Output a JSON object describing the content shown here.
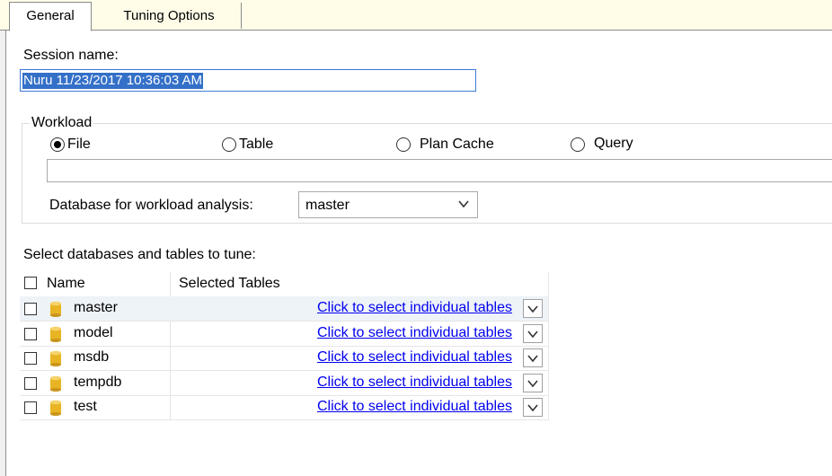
{
  "tabs": [
    "General",
    "Tuning Options"
  ],
  "session": {
    "label": "Session name:",
    "value": "Nuru 11/23/2017 10:36:03 AM"
  },
  "workload": {
    "legend": "Workload",
    "options": [
      {
        "label": "File",
        "checked": true
      },
      {
        "label": "Table",
        "checked": false
      },
      {
        "label": "Plan Cache",
        "checked": false
      },
      {
        "label": "Query",
        "checked": false
      }
    ],
    "input_value": "",
    "db_label": "Database for workload analysis:",
    "db_selected": "master"
  },
  "grid": {
    "caption": "Select databases and tables to tune:",
    "headers": {
      "name": "Name",
      "tables": "Selected Tables"
    },
    "rows": [
      {
        "name": "master",
        "link": "Click to select individual tables",
        "checked": false
      },
      {
        "name": "model",
        "link": "Click to select individual tables",
        "checked": false
      },
      {
        "name": "msdb",
        "link": "Click to select individual tables",
        "checked": false
      },
      {
        "name": "tempdb",
        "link": "Click to select individual tables",
        "checked": false
      },
      {
        "name": "test",
        "link": "Click to select individual tables",
        "checked": false
      }
    ]
  },
  "icons": {
    "database": "database-cylinder-icon",
    "dropdown": "chevron-down-icon",
    "db_color": "#e8b423"
  }
}
